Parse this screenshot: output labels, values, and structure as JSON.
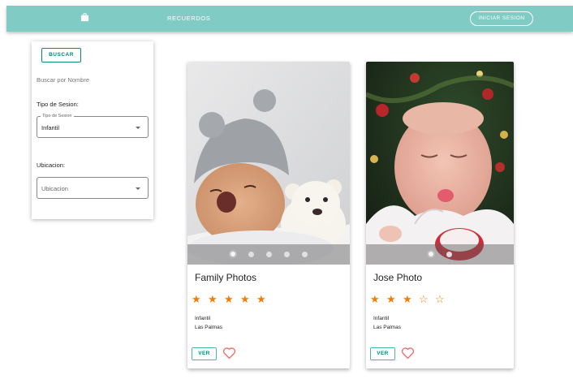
{
  "appbar": {
    "nav_label": "RECUERDOS",
    "login_label": "INICIAR SESION",
    "icon": "shopping-bag-icon",
    "color": "#80cbc4"
  },
  "filters": {
    "search_button": "BUSCAR",
    "search_by_name": "Buscar por Nombre",
    "session_type_label": "Tipo de Sesion:",
    "session_type_floating": "Tipo de Sesion",
    "session_type_value": "Infantil",
    "location_label": "Ubicacion:",
    "location_placeholder": "Ubicacion"
  },
  "cards": [
    {
      "title": "Family Photos",
      "rating": 5,
      "stars": [
        "★",
        "★",
        "★",
        "★",
        "★"
      ],
      "category": "Infantil",
      "location": "Las Palmas",
      "view_label": "VER",
      "slides": 5,
      "active_slide": 1
    },
    {
      "title": "Jose Photo",
      "rating": 3,
      "stars": [
        "★",
        "★",
        "★",
        "☆",
        "☆"
      ],
      "category": "Infantil",
      "location": "Las Palmas",
      "view_label": "VER",
      "slides": 2,
      "active_slide": 1
    }
  ],
  "colors": {
    "accent": "#00897b",
    "star": "#f57c00",
    "heart": "#e57373"
  }
}
